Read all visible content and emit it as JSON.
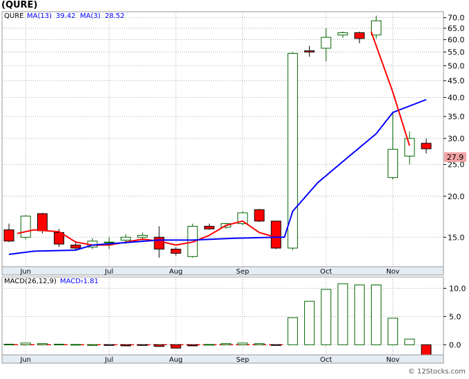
{
  "ticker": "(QURE)",
  "colors": {
    "up": "#006400",
    "down": "#ff0000",
    "ma13": "#0000ff",
    "ma3": "#ff0000",
    "macd_line": "#ff0000",
    "grid": "#aaaaaa",
    "axis_bg": "#e4ecf4",
    "last_bg": "#f4a4a4"
  },
  "price_legend": {
    "symbol": "QURE",
    "ma13_label": "MA(13)",
    "ma13_value": "39.42",
    "ma3_label": "MA(3)",
    "ma3_value": "28.52"
  },
  "macd_legend": {
    "params": "MACD(26,12,9)",
    "label": "MACD:",
    "value": "-1.81"
  },
  "last_price_label": "27.9",
  "watermark": "© 12Stocks.com",
  "chart_data": [
    {
      "type": "candlestick",
      "scale": "log",
      "ylim": [
        12.2,
        73
      ],
      "y_ticks": [
        15.0,
        20.0,
        25.0,
        30.0,
        35.0,
        40.0,
        45.0,
        50.0,
        55.0,
        60.0,
        65.0,
        70.0
      ],
      "y_tick_labels": [
        "15.0",
        "20.0",
        "25.0",
        "30.0",
        "35.0",
        "40.0",
        "45.0",
        "50.0",
        "55.0",
        "60.0",
        "65.0",
        "70.0"
      ],
      "x_labels": [
        "Jun",
        "Jul",
        "Aug",
        "Sep",
        "Oct",
        "Nov"
      ],
      "x_label_weeks": [
        1,
        6,
        10,
        14,
        19,
        23
      ],
      "candles": [
        {
          "o": 15.8,
          "h": 16.5,
          "l": 14.5,
          "c": 14.6
        },
        {
          "o": 15.0,
          "h": 17.5,
          "l": 14.8,
          "c": 17.4
        },
        {
          "o": 17.7,
          "h": 17.8,
          "l": 15.4,
          "c": 15.7
        },
        {
          "o": 15.5,
          "h": 15.9,
          "l": 14.0,
          "c": 14.3
        },
        {
          "o": 14.2,
          "h": 14.6,
          "l": 13.7,
          "c": 13.9
        },
        {
          "o": 14.0,
          "h": 14.9,
          "l": 13.8,
          "c": 14.6
        },
        {
          "o": 14.5,
          "h": 15.0,
          "l": 13.8,
          "c": 14.5
        },
        {
          "o": 14.7,
          "h": 15.3,
          "l": 14.3,
          "c": 15.0
        },
        {
          "o": 15.0,
          "h": 15.5,
          "l": 14.5,
          "c": 15.2
        },
        {
          "o": 15.0,
          "h": 16.2,
          "l": 13.0,
          "c": 13.8
        },
        {
          "o": 13.8,
          "h": 14.0,
          "l": 13.2,
          "c": 13.4
        },
        {
          "o": 13.1,
          "h": 16.5,
          "l": 13.0,
          "c": 16.2
        },
        {
          "o": 16.2,
          "h": 16.5,
          "l": 15.8,
          "c": 15.9
        },
        {
          "o": 16.1,
          "h": 16.6,
          "l": 15.9,
          "c": 16.5
        },
        {
          "o": 16.5,
          "h": 18.0,
          "l": 16.3,
          "c": 17.8
        },
        {
          "o": 18.2,
          "h": 18.3,
          "l": 16.7,
          "c": 16.8
        },
        {
          "o": 16.8,
          "h": 16.8,
          "l": 13.8,
          "c": 13.9
        },
        {
          "o": 13.9,
          "h": 55.0,
          "l": 13.7,
          "c": 54.5
        },
        {
          "o": 55.5,
          "h": 57.5,
          "l": 53.2,
          "c": 55.0
        },
        {
          "o": 56.5,
          "h": 65.0,
          "l": 51.5,
          "c": 61.0
        },
        {
          "o": 62.0,
          "h": 63.5,
          "l": 60.8,
          "c": 63.0
        },
        {
          "o": 63.0,
          "h": 63.5,
          "l": 58.5,
          "c": 60.5
        },
        {
          "o": 62.0,
          "h": 71.0,
          "l": 60.5,
          "c": 68.5
        },
        {
          "o": 22.8,
          "h": 36.0,
          "l": 22.5,
          "c": 27.8
        },
        {
          "o": 26.5,
          "h": 31.5,
          "l": 25.0,
          "c": 30.0
        },
        {
          "o": 29.0,
          "h": 30.0,
          "l": 27.0,
          "c": 27.9
        }
      ],
      "ma13": [
        {
          "w": 0,
          "v": 13.3
        },
        {
          "w": 1.5,
          "v": 13.6
        },
        {
          "w": 4,
          "v": 13.7
        },
        {
          "w": 5,
          "v": 14.2
        },
        {
          "w": 9,
          "v": 14.7
        },
        {
          "w": 11,
          "v": 14.7
        },
        {
          "w": 13.5,
          "v": 14.9
        },
        {
          "w": 16,
          "v": 15.0
        },
        {
          "w": 16.5,
          "v": 15.0
        },
        {
          "w": 17,
          "v": 18.0
        },
        {
          "w": 18.5,
          "v": 22.0
        },
        {
          "w": 20,
          "v": 25.5
        },
        {
          "w": 22,
          "v": 31.0
        },
        {
          "w": 23,
          "v": 36.0
        },
        {
          "w": 25,
          "v": 39.4
        }
      ],
      "ma3": [
        {
          "w": 0.5,
          "v": 15.4
        },
        {
          "w": 1.5,
          "v": 15.8
        },
        {
          "w": 3,
          "v": 15.6
        },
        {
          "w": 4,
          "v": 14.5
        },
        {
          "w": 5,
          "v": 14.2
        },
        {
          "w": 6,
          "v": 14.2
        },
        {
          "w": 7,
          "v": 14.5
        },
        {
          "w": 8,
          "v": 14.8
        },
        {
          "w": 9,
          "v": 14.6
        },
        {
          "w": 10,
          "v": 14.2
        },
        {
          "w": 11,
          "v": 14.5
        },
        {
          "w": 12,
          "v": 15.2
        },
        {
          "w": 13,
          "v": 16.3
        },
        {
          "w": 14,
          "v": 16.8
        },
        {
          "w": 15,
          "v": 15.5
        },
        {
          "w": 16,
          "v": 15.0
        }
      ],
      "ma3_tail": [
        {
          "w": 21.7,
          "v": 63.5
        },
        {
          "w": 23,
          "v": 41.5
        },
        {
          "w": 24,
          "v": 28.5
        }
      ]
    },
    {
      "type": "bar",
      "ylim": [
        -1.8,
        12.0
      ],
      "y_ticks": [
        0.0,
        5.0,
        10.0
      ],
      "y_tick_labels": [
        "0.0",
        "5.0",
        "10.0"
      ],
      "x_labels": [
        "Jun",
        "Jul",
        "Aug",
        "Sep",
        "Oct",
        "Nov"
      ],
      "x_label_weeks": [
        1,
        6,
        10,
        14,
        19,
        23
      ],
      "values": [
        0.1,
        0.3,
        0.2,
        0.1,
        0.05,
        0.0,
        -0.1,
        -0.2,
        -0.1,
        -0.3,
        -0.6,
        -0.2,
        0.05,
        0.2,
        0.3,
        0.2,
        -0.1,
        4.8,
        7.7,
        9.8,
        10.8,
        10.6,
        10.6,
        4.7,
        1.0,
        -1.81
      ]
    }
  ]
}
